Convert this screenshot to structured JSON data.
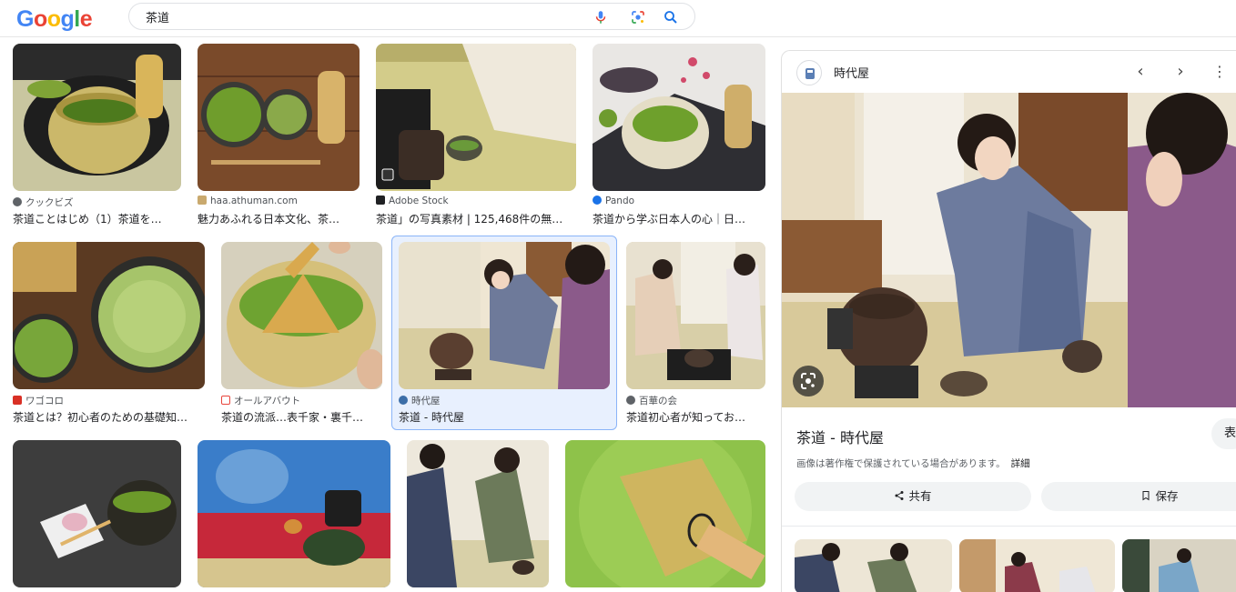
{
  "header": {
    "logo_letters": [
      "G",
      "o",
      "o",
      "g",
      "l",
      "e"
    ],
    "logo_colors": [
      "#4285f4",
      "#ea4335",
      "#fbbc05",
      "#4285f4",
      "#34a853",
      "#ea4335"
    ],
    "search_value": "茶道"
  },
  "results": [
    {
      "source": "クックビズ",
      "title": "茶道ことはじめ（1）茶道を…",
      "fav_color": "#5f6368"
    },
    {
      "source": "haa.athuman.com",
      "title": "魅力あふれる日本文化、茶…",
      "fav_color": "#c9a96e"
    },
    {
      "source": "Adobe Stock",
      "title": "茶道」の写真素材 | 125,468件の無…",
      "fav_color": "#202124"
    },
    {
      "source": "Pando",
      "title": "茶道から学ぶ日本人の心｜日…",
      "fav_color": "#1a73e8"
    },
    {
      "source": "ワゴコロ",
      "title": "茶道とは？初心者のための基礎知…",
      "fav_color": "#d93025"
    },
    {
      "source": "オールアバウト",
      "title": "茶道の流派…表千家・裏千…",
      "fav_color": "#e8453c"
    },
    {
      "source": "時代屋",
      "title": "茶道 - 時代屋",
      "fav_color": "#3c6ea8"
    },
    {
      "source": "百華の会",
      "title": "茶道初心者が知ってお…",
      "fav_color": "#5f6368"
    }
  ],
  "panel": {
    "site": "時代屋",
    "title": "茶道 - 時代屋",
    "side_button_label": "表",
    "copyright_note": "画像は著作権で保護されている場合があります。",
    "details_link": "詳細",
    "share_label": "共有",
    "save_label": "保存"
  }
}
